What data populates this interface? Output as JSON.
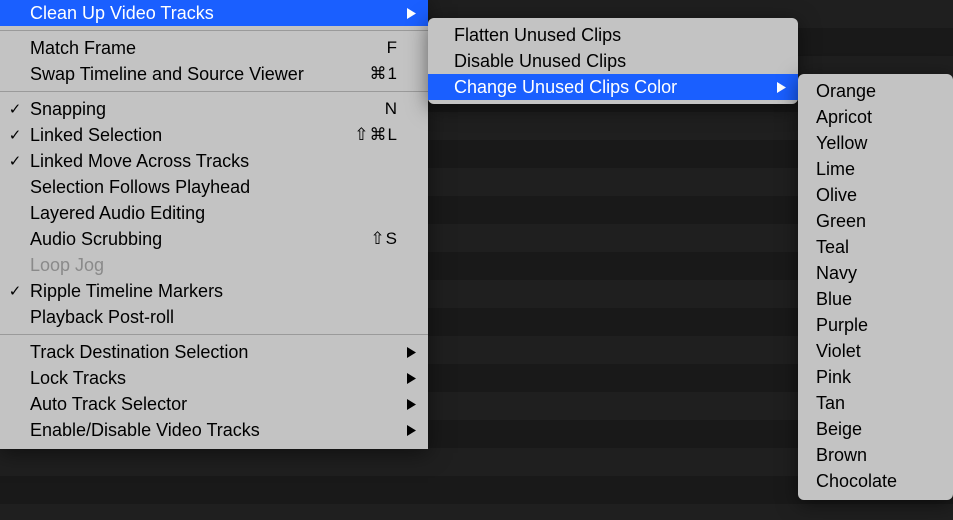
{
  "colors": {
    "highlight": "#1a5fff",
    "menu_bg": "#c3c3c3",
    "disabled": "#8a8a8a"
  },
  "menu_main": {
    "groups": [
      [
        {
          "label": "Clean Up Video Tracks",
          "submenu": true,
          "highlighted": true
        }
      ],
      [
        {
          "label": "Match Frame",
          "shortcut": "F"
        },
        {
          "label": "Swap Timeline and Source Viewer",
          "shortcut": "⌘1"
        }
      ],
      [
        {
          "label": "Snapping",
          "shortcut": "N",
          "checked": true
        },
        {
          "label": "Linked Selection",
          "shortcut": "⇧⌘L",
          "checked": true
        },
        {
          "label": "Linked Move Across Tracks",
          "checked": true
        },
        {
          "label": "Selection Follows Playhead"
        },
        {
          "label": "Layered Audio Editing"
        },
        {
          "label": "Audio Scrubbing",
          "shortcut": "⇧S"
        },
        {
          "label": "Loop Jog",
          "disabled": true
        },
        {
          "label": "Ripple Timeline Markers",
          "checked": true
        },
        {
          "label": "Playback Post-roll"
        }
      ],
      [
        {
          "label": "Track Destination Selection",
          "submenu": true
        },
        {
          "label": "Lock Tracks",
          "submenu": true
        },
        {
          "label": "Auto Track Selector",
          "submenu": true
        },
        {
          "label": "Enable/Disable Video Tracks",
          "submenu": true
        }
      ]
    ]
  },
  "menu_sub1": {
    "items": [
      {
        "label": "Flatten Unused Clips"
      },
      {
        "label": "Disable Unused Clips"
      },
      {
        "label": "Change Unused Clips Color",
        "submenu": true,
        "highlighted": true
      }
    ]
  },
  "menu_sub2": {
    "items": [
      {
        "label": "Orange"
      },
      {
        "label": "Apricot"
      },
      {
        "label": "Yellow"
      },
      {
        "label": "Lime"
      },
      {
        "label": "Olive"
      },
      {
        "label": "Green"
      },
      {
        "label": "Teal"
      },
      {
        "label": "Navy"
      },
      {
        "label": "Blue"
      },
      {
        "label": "Purple"
      },
      {
        "label": "Violet"
      },
      {
        "label": "Pink"
      },
      {
        "label": "Tan"
      },
      {
        "label": "Beige"
      },
      {
        "label": "Brown"
      },
      {
        "label": "Chocolate"
      }
    ]
  }
}
